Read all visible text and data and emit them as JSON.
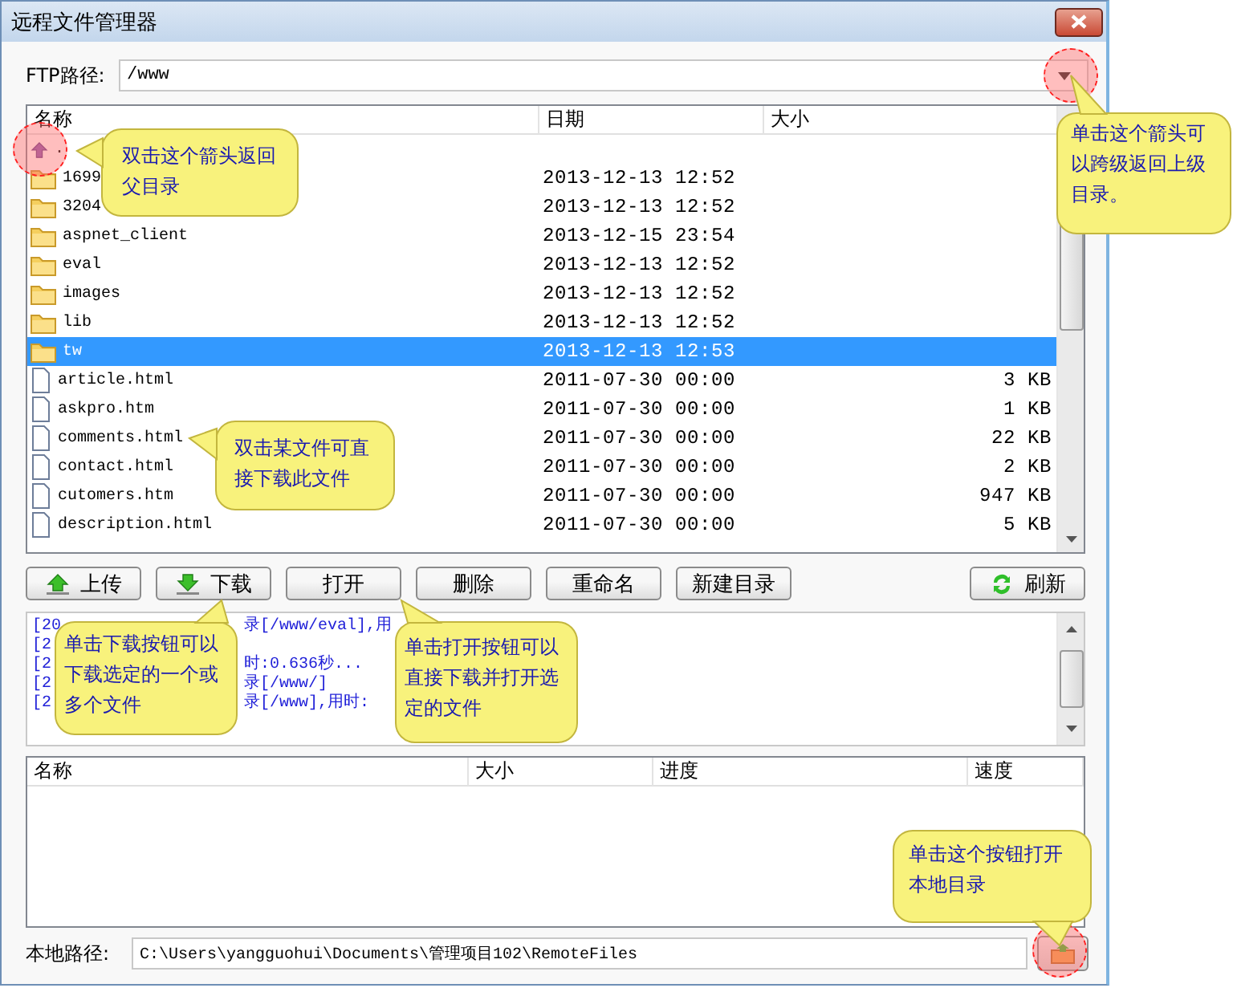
{
  "window": {
    "title": "远程文件管理器"
  },
  "ftp_path": {
    "label": "FTP路径:",
    "value": "/www"
  },
  "file_list": {
    "columns": [
      "名称",
      "日期",
      "大小"
    ],
    "rows": [
      {
        "kind": "up",
        "name": ".",
        "selected": false
      },
      {
        "kind": "folder",
        "name": "1699",
        "date": "2013-12-13 12:52",
        "selected": false
      },
      {
        "kind": "folder",
        "name": "3204",
        "date": "2013-12-13 12:52",
        "selected": false
      },
      {
        "kind": "folder",
        "name": "aspnet_client",
        "date": "2013-12-15 23:54",
        "selected": false
      },
      {
        "kind": "folder",
        "name": "eval",
        "date": "2013-12-13 12:52",
        "selected": false
      },
      {
        "kind": "folder",
        "name": "images",
        "date": "2013-12-13 12:52",
        "selected": false
      },
      {
        "kind": "folder",
        "name": "lib",
        "date": "2013-12-13 12:52",
        "selected": false
      },
      {
        "kind": "folder",
        "name": "tw",
        "date": "2013-12-13 12:53",
        "selected": true
      },
      {
        "kind": "file",
        "name": "article.html",
        "date": "2011-07-30 00:00",
        "size": "3 KB",
        "selected": false
      },
      {
        "kind": "file",
        "name": "askpro.htm",
        "date": "2011-07-30 00:00",
        "size": "1 KB",
        "selected": false
      },
      {
        "kind": "file",
        "name": "comments.html",
        "date": "2011-07-30 00:00",
        "size": "22 KB",
        "selected": false
      },
      {
        "kind": "file",
        "name": "contact.html",
        "date": "2011-07-30 00:00",
        "size": "2 KB",
        "selected": false
      },
      {
        "kind": "file",
        "name": "cutomers.htm",
        "date": "2011-07-30 00:00",
        "size": "947 KB",
        "selected": false
      },
      {
        "kind": "file",
        "name": "description.html",
        "date": "2011-07-30 00:00",
        "size": "5 KB",
        "selected": false
      }
    ]
  },
  "toolbar": [
    {
      "label": "上传",
      "kind": "upload"
    },
    {
      "label": "下载",
      "kind": "download"
    },
    {
      "label": "打开",
      "kind": "plain"
    },
    {
      "label": "删除",
      "kind": "plain"
    },
    {
      "label": "重命名",
      "kind": "plain"
    },
    {
      "label": "新建目录",
      "kind": "plain"
    },
    {
      "label": "刷新",
      "kind": "refresh"
    }
  ],
  "log": [
    {
      "start": "[20",
      "end": "录[/www/eval],用"
    },
    {
      "start": "[2"
    },
    {
      "start": "[2",
      "end": "时:0.636秒..."
    },
    {
      "start": "[2",
      "end": "录[/www/]"
    },
    {
      "start": "[2",
      "end": "录[/www],用时:"
    }
  ],
  "transfer_list": {
    "columns": [
      "名称",
      "大小",
      "进度",
      "速度"
    ]
  },
  "local_path": {
    "label": "本地路径:",
    "value": "C:\\Users\\yangguohui\\Documents\\管理项目102\\RemoteFiles"
  },
  "callouts": [
    {
      "text": "双击这个箭头返回父目录"
    },
    {
      "text": "单击这个箭头可以跨级返回上级目录。"
    },
    {
      "text": "双击某文件可直接下载此文件"
    },
    {
      "text": "单击下载按钮可以下载选定的一个或多个文件"
    },
    {
      "text": "单击打开按钮可以直接下载并打开选定的文件"
    },
    {
      "text": "单击这个按钮打开本地目录"
    }
  ]
}
